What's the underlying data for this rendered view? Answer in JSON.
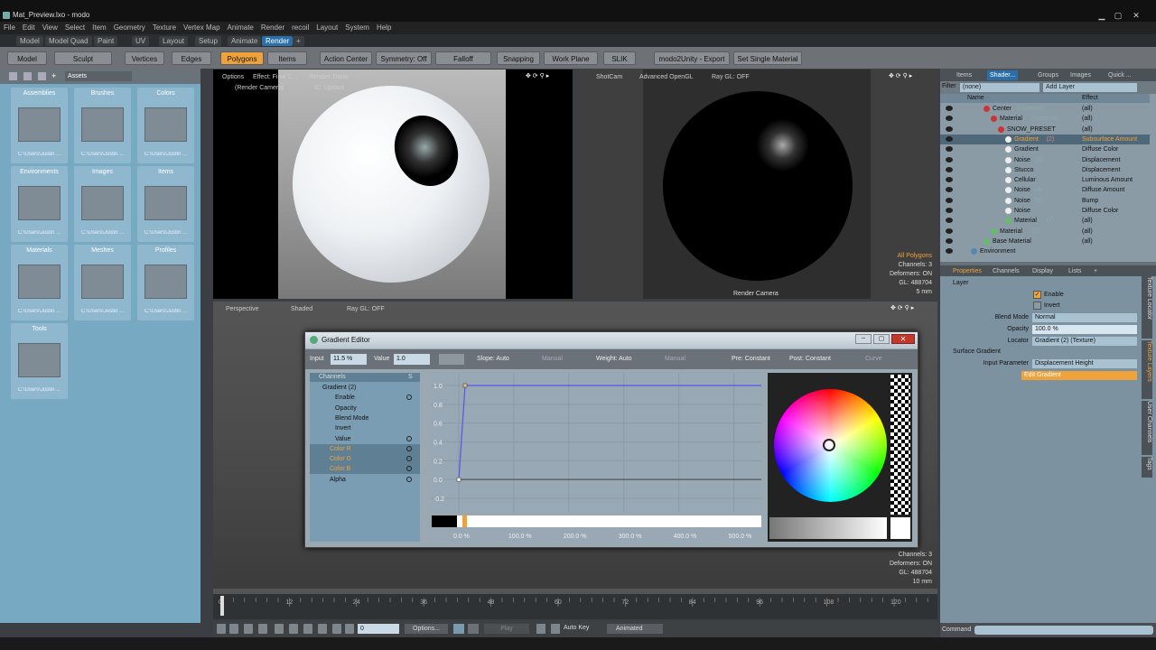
{
  "window": {
    "title": "Mat_Preview.lxo - modo"
  },
  "menu": [
    "File",
    "Edit",
    "View",
    "Select",
    "Item",
    "Geometry",
    "Texture",
    "Vertex Map",
    "Animate",
    "Render",
    "recoil",
    "Layout",
    "System",
    "Help"
  ],
  "layout_tabs": [
    "Model",
    "Model Quad",
    "Paint",
    "UV",
    "Layout",
    "Setup",
    "Animate",
    "Render",
    "+"
  ],
  "toolbar": {
    "model": "Model",
    "sculpt": "Sculpt",
    "vertices": "Vertices",
    "edges": "Edges",
    "polygons": "Polygons",
    "items": "Items",
    "action_center": "Action Center",
    "symmetry": "Symmetry: Off",
    "falloff": "Falloff",
    "snapping": "Snapping",
    "work_plane": "Work Plane",
    "slik": "SLIK",
    "modo2unity": "modo2Unity - Export",
    "set_single_material": "Set Single Material"
  },
  "presets": {
    "dropdown": "Assets",
    "tiles": [
      {
        "label": "Assemblies",
        "path": "C:\\Users\\Justin ..."
      },
      {
        "label": "Brushes",
        "path": "C:\\Users\\Justin ..."
      },
      {
        "label": "Colors",
        "path": "C:\\Users\\Justin ..."
      },
      {
        "label": "Environments",
        "path": "C:\\Users\\Justin ..."
      },
      {
        "label": "Images",
        "path": "C:\\Users\\Justin ..."
      },
      {
        "label": "Items",
        "path": "C:\\Users\\Justin ..."
      },
      {
        "label": "Materials",
        "path": "C:\\Users\\Justin ..."
      },
      {
        "label": "Meshes",
        "path": "C:\\Users\\Justin ..."
      },
      {
        "label": "Profiles",
        "path": "C:\\Users\\Justin ..."
      },
      {
        "label": "Tools",
        "path": "C:\\Users\\Justin ..."
      }
    ]
  },
  "viewport_preview": {
    "options": "Options",
    "effect": "Effect: Final C...",
    "render": "Render: Done",
    "camera": "(Render Camera)",
    "ic": "IC: Update"
  },
  "viewport_camera": {
    "shotcam": "ShotCam",
    "advanced": "Advanced OpenGL",
    "raygl": "Ray GL: OFF",
    "label": "Render Camera",
    "info": [
      "All Polygons",
      "Channels: 3",
      "Deformers: ON",
      "GL: 488704",
      "5 mm"
    ]
  },
  "viewport_persp": {
    "perspective": "Perspective",
    "shaded": "Shaded",
    "raygl": "Ray GL: OFF",
    "info": [
      "Channels: 3",
      "Deformers: ON",
      "GL: 488704",
      "10 mm"
    ]
  },
  "gradient_editor": {
    "title": "Gradient Editor",
    "input_label": "Input",
    "input_value": "11.5 %",
    "value_label": "Value",
    "value_value": "1.0",
    "slope": "Slope: Auto",
    "manual1": "Manual",
    "weight": "Weight: Auto",
    "manual2": "Manual",
    "pre": "Pre: Constant",
    "post": "Post: Constant",
    "curve": "Curve",
    "channels_header": "Channels",
    "s_header": "S",
    "channels": [
      "Gradient (2)",
      "Enable",
      "Opacity",
      "Blend Mode",
      "Invert",
      "Value",
      "Color R",
      "Color G",
      "Color B",
      "Alpha"
    ],
    "y_ticks": [
      "1.0",
      "0.8",
      "0.6",
      "0.4",
      "0.2",
      "0.0",
      "-0.2"
    ],
    "x_ticks": [
      "0.0 %",
      "100.0 %",
      "200.0 %",
      "300.0 %",
      "400.0 %",
      "500.0 %"
    ]
  },
  "shader_tree": {
    "tabs": [
      "Items",
      "Shader...",
      "Groups",
      "Images",
      "Quick ..."
    ],
    "filter_label": "Filter",
    "filter_value": "(none)",
    "add_layer": "Add Layer",
    "col_name": "Name",
    "col_effect": "Effect",
    "rows": [
      {
        "name": "Center",
        "sub": "(Material)",
        "effect": "(all)"
      },
      {
        "name": "Material",
        "sub": "(Material)",
        "effect": "(all)"
      },
      {
        "name": "SNOW_PRESET",
        "sub": "",
        "effect": "(all)"
      },
      {
        "name": "Gradient",
        "sub": "(2)",
        "effect": "Subsurface Amount"
      },
      {
        "name": "Gradient",
        "sub": "",
        "effect": "Diffuse Color"
      },
      {
        "name": "Noise",
        "sub": "(3)",
        "effect": "Displacement"
      },
      {
        "name": "Stucco",
        "sub": "",
        "effect": "Displacement"
      },
      {
        "name": "Cellular",
        "sub": "",
        "effect": "Luminous Amount"
      },
      {
        "name": "Noise",
        "sub": "(4)",
        "effect": "Diffuse Amount"
      },
      {
        "name": "Noise",
        "sub": "(2)",
        "effect": "Bump"
      },
      {
        "name": "Noise",
        "sub": "",
        "effect": "Diffuse Color"
      },
      {
        "name": "Material",
        "sub": "(7)",
        "effect": "(all)"
      },
      {
        "name": "Material",
        "sub": "(6)",
        "effect": "(all)"
      },
      {
        "name": "Base Material",
        "sub": "",
        "effect": "(all)"
      },
      {
        "name": "Environment",
        "sub": "",
        "effect": ""
      }
    ]
  },
  "properties": {
    "tabs": [
      "Properties",
      "Channels",
      "Display",
      "Lists",
      "+"
    ],
    "layer_label": "Layer",
    "enable": "Enable",
    "invert": "Invert",
    "blend_mode_label": "Blend Mode",
    "blend_mode": "Normal",
    "opacity_label": "Opacity",
    "opacity": "100.0 %",
    "locator_label": "Locator",
    "locator": "Gradient (2) (Texture)",
    "surface_gradient": "Surface Gradient",
    "input_param_label": "Input Parameter",
    "input_param": "Displacement Height",
    "edit_gradient": "Edit Gradient",
    "side_tabs": [
      "Texture Locator",
      "Texture Layers",
      "User Channels",
      "Tags"
    ]
  },
  "timeline": {
    "ticks": [
      "0",
      "12",
      "24",
      "36",
      "48",
      "60",
      "72",
      "84",
      "96",
      "108",
      "120"
    ]
  },
  "transport": {
    "frame": "0",
    "options": "Options...",
    "play": "Play",
    "auto_key": "Auto Key",
    "animated": "Animated"
  },
  "command": {
    "label": "Command"
  }
}
